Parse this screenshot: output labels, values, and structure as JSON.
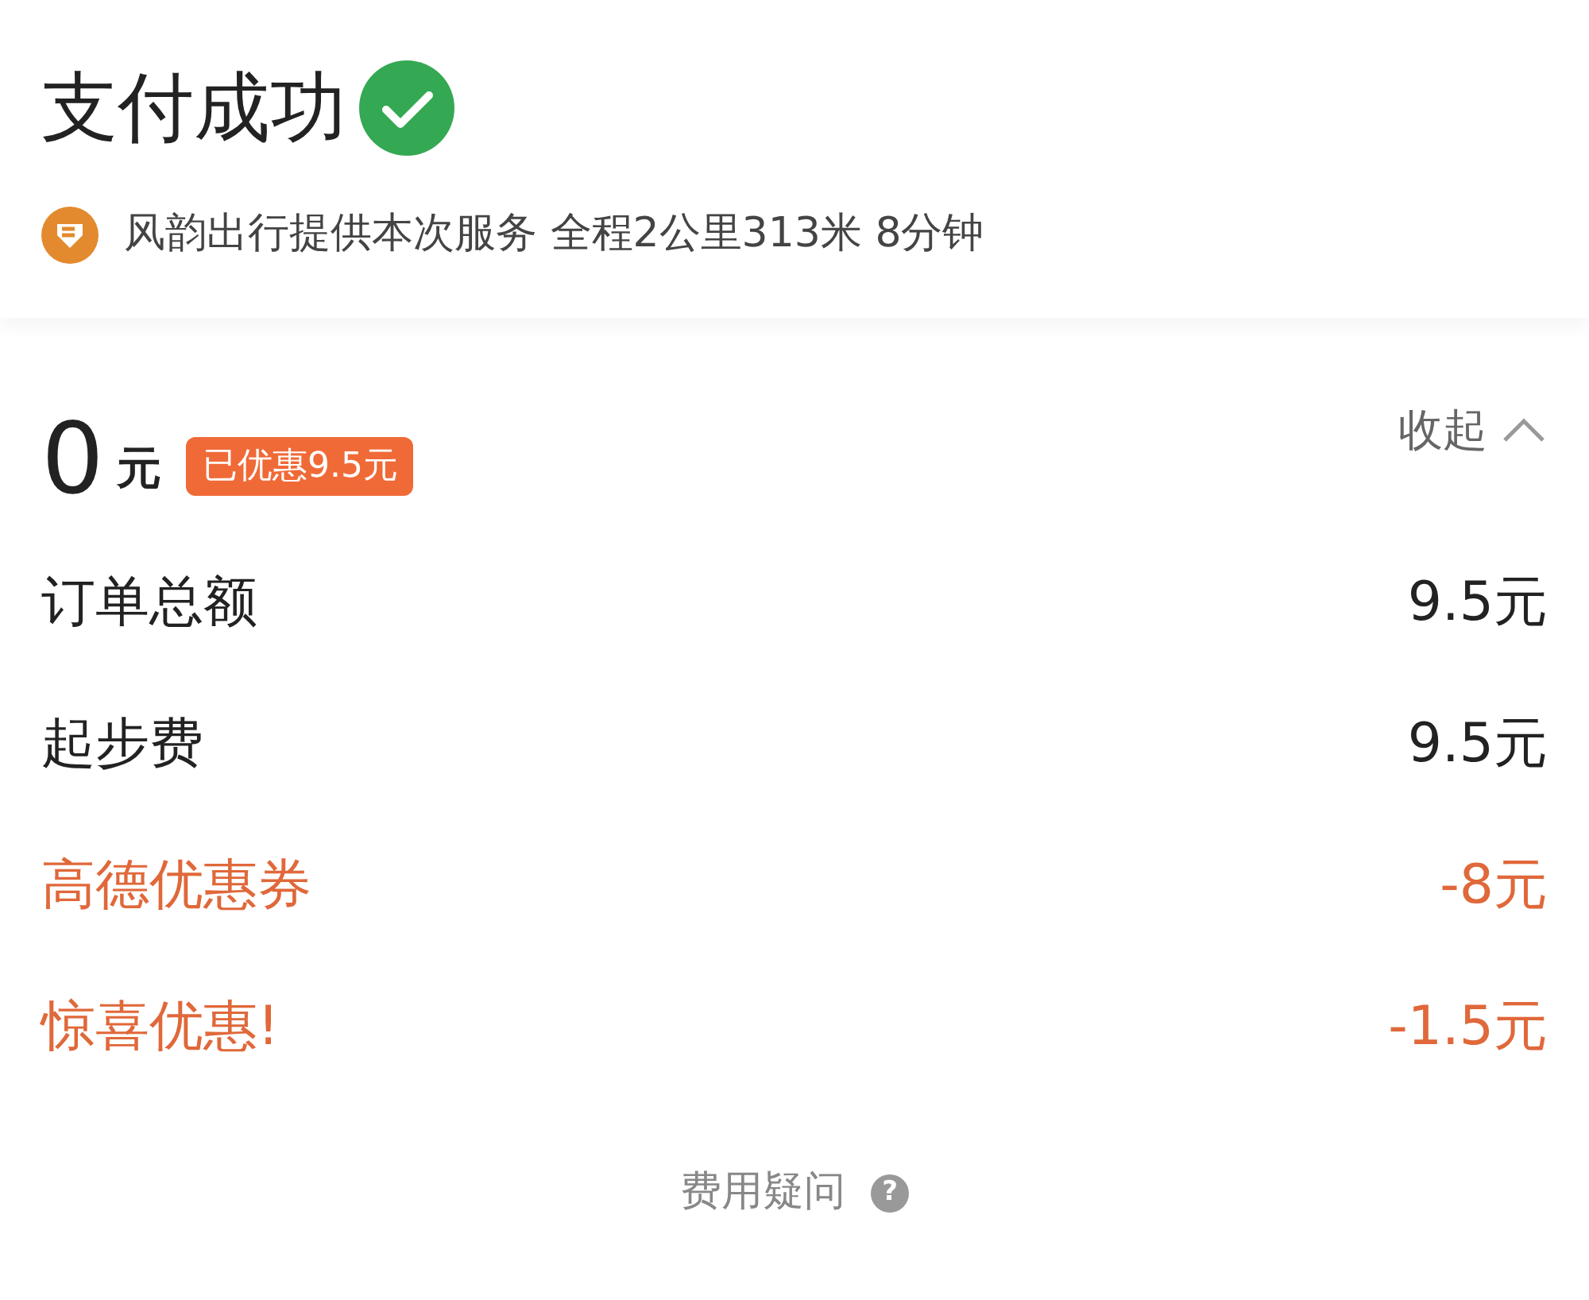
{
  "header": {
    "title": "支付成功",
    "provider_line": "风韵出行提供本次服务 全程2公里313米 8分钟"
  },
  "summary": {
    "amount": "0",
    "unit": "元",
    "discount_badge": "已优惠9.5元",
    "toggle": "收起",
    "expanded": true
  },
  "rows": [
    {
      "kind": "charge",
      "label": "订单总额",
      "value": "9.5元"
    },
    {
      "kind": "charge",
      "label": "起步费",
      "value": "9.5元"
    },
    {
      "kind": "discount",
      "label": "高德优惠券",
      "value": "-8元"
    },
    {
      "kind": "discount",
      "label": "惊喜优惠!",
      "value": "-1.5元"
    }
  ],
  "footer": {
    "label": "费用疑问",
    "help_glyph": "?"
  }
}
